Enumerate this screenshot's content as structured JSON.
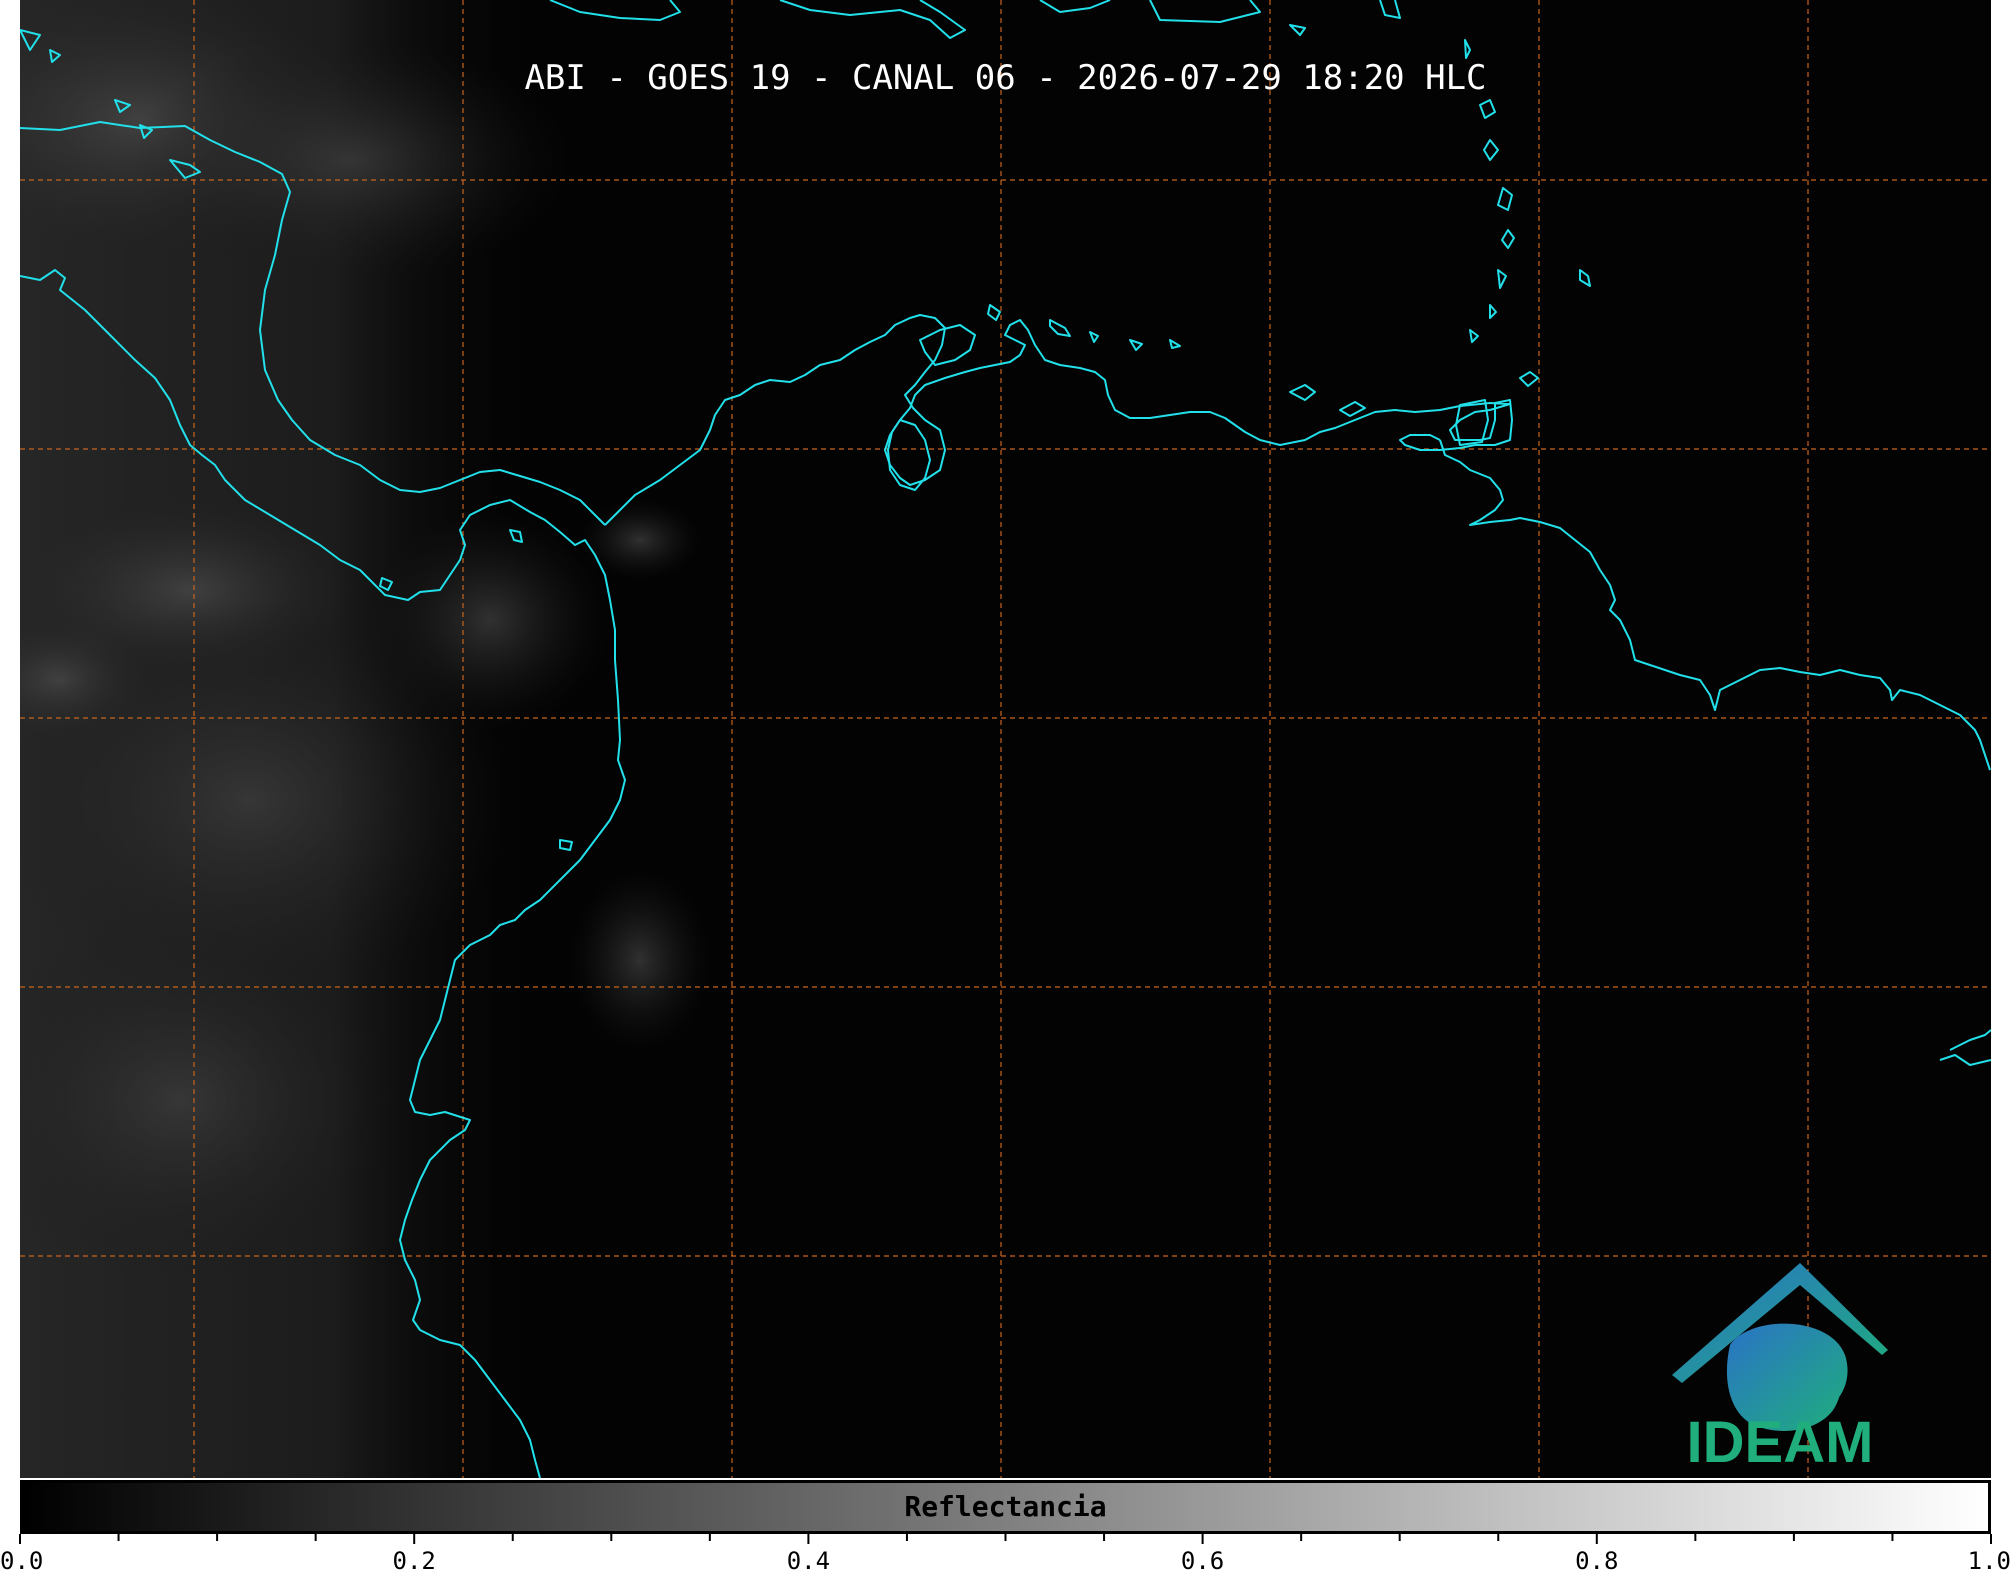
{
  "map": {
    "title": "ABI - GOES 19 - CANAL 06 - 2026-07-29 18:20 HLC",
    "background_color": "#030303",
    "coastline_color": "#22e0ea",
    "gridline_color": "#c8641e",
    "grid": true
  },
  "logo": {
    "text": "IDEAM",
    "icon": "ideam-spiral-mountain-logo",
    "colors": [
      "#2a73c6",
      "#1fae7c"
    ]
  },
  "colorbar": {
    "label": "Reflectancia",
    "range": [
      0.0,
      1.0
    ],
    "tick_labels": [
      "0.0",
      "0.2",
      "0.4",
      "0.6",
      "0.8",
      "1.0"
    ],
    "colors": [
      "#000000",
      "#ffffff"
    ]
  }
}
